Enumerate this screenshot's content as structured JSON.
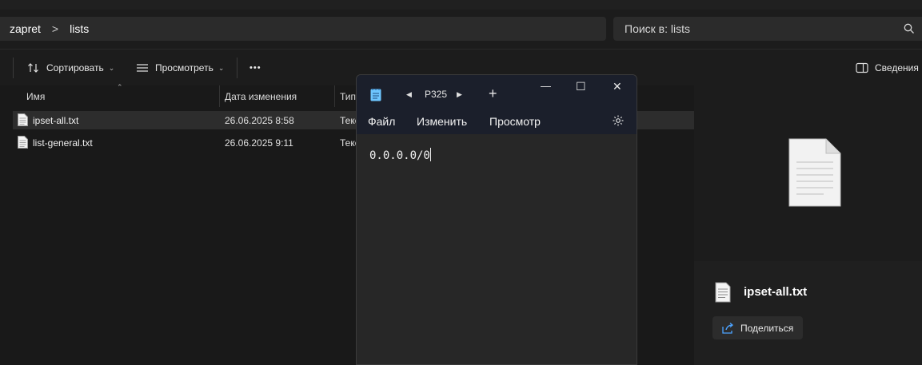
{
  "address": {
    "crumbs": [
      "zapret",
      "lists"
    ],
    "separator": ">"
  },
  "search": {
    "placeholder": "Поиск в: lists"
  },
  "toolbar": {
    "sort_label": "Сортировать",
    "view_label": "Просмотреть",
    "more_label": "•••",
    "details_label": "Сведения"
  },
  "columns": {
    "name": "Имя",
    "date": "Дата изменения",
    "type": "Тип"
  },
  "files": [
    {
      "name": "ipset-all.txt",
      "date": "26.06.2025 8:58",
      "type": "Текс"
    },
    {
      "name": "list-general.txt",
      "date": "26.06.2025 9:11",
      "type": "Текс"
    }
  ],
  "details_pane": {
    "file_name": "ipset-all.txt",
    "share_label": "Поделиться"
  },
  "notepad": {
    "tab_title": "P325",
    "new_tab": "+",
    "min": "—",
    "max": "☐",
    "close": "✕",
    "menu": {
      "file": "Файл",
      "edit": "Изменить",
      "view": "Просмотр"
    },
    "content": "0.0.0.0/0"
  },
  "colors": {
    "background": "#191919",
    "notepad_title": "#1b1f2b",
    "accent": "#4ca3ff"
  }
}
